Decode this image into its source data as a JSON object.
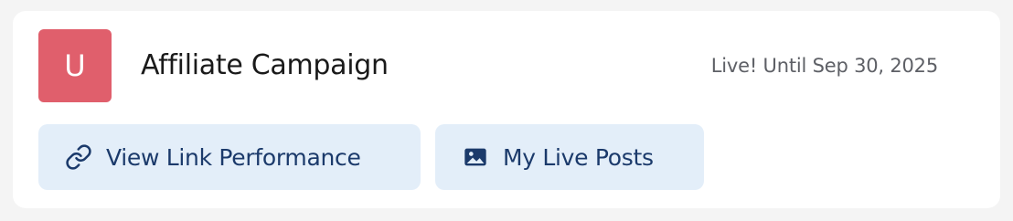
{
  "campaign": {
    "avatar_letter": "U",
    "avatar_color": "#e05f6c",
    "title": "Affiliate Campaign",
    "status": "Live! Until Sep 30, 2025"
  },
  "actions": {
    "link_performance": {
      "label": "View Link Performance",
      "icon": "link-icon"
    },
    "live_posts": {
      "label": "My Live Posts",
      "icon": "image-icon"
    }
  },
  "colors": {
    "button_bg": "#e3eef9",
    "button_text": "#1b3a6b"
  }
}
